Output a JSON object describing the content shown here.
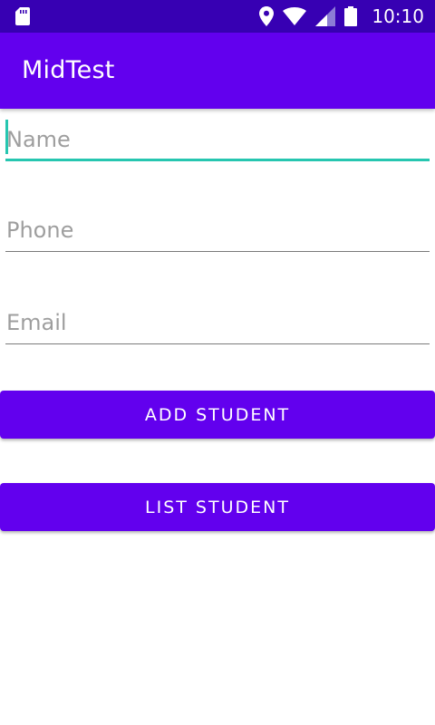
{
  "status_bar": {
    "time": "10:10",
    "icons": [
      "sd-card-icon",
      "location-icon",
      "wifi-icon",
      "signal-icon",
      "battery-icon"
    ],
    "background_color": "#3700b3"
  },
  "app_bar": {
    "title": "MidTest",
    "background_color": "#6200ee"
  },
  "form": {
    "name": {
      "placeholder": "Name",
      "value": ""
    },
    "phone": {
      "placeholder": "Phone",
      "value": ""
    },
    "email": {
      "placeholder": "Email",
      "value": ""
    },
    "focused_field": "name",
    "accent_color": "#26c6b0"
  },
  "buttons": {
    "add_student": "ADD STUDENT",
    "list_student": "LIST STUDENT",
    "color": "#6200ee"
  }
}
